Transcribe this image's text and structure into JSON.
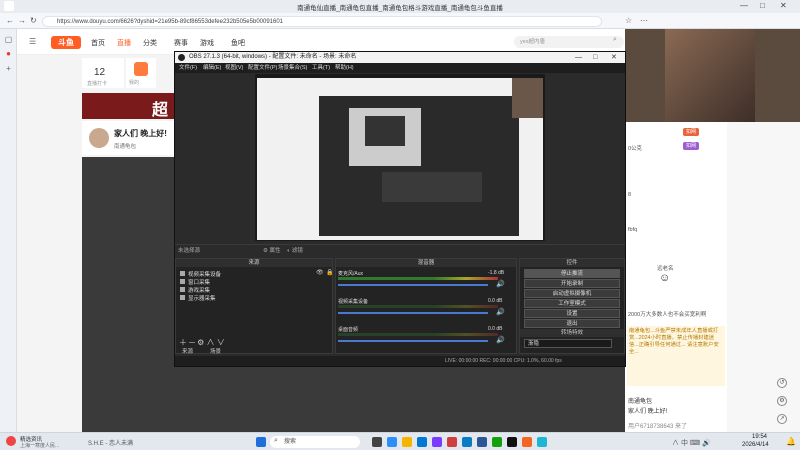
{
  "browser": {
    "title": "南通龟仙直播_南通龟包直播_南通龟包格斗游戏直播_南通龟包斗鱼直播",
    "url": "https://www.douyu.com/6626?dyshid=21e95b-89cf86553defee232b505e5b00091601",
    "win_min": "—",
    "win_max": "□",
    "win_close": "✕"
  },
  "douyu": {
    "logo": "斗鱼",
    "nav": [
      "首页",
      "直播",
      "分类",
      "赛事",
      "游戏",
      "鱼吧"
    ],
    "search_placeholder": "yes超内唐",
    "follow_count": "12",
    "follow_label": "直播打卡",
    "fan_label": "我的",
    "banner_text": "超",
    "streamer_title": "家人们 晚上好!",
    "streamer_tag": "南通龟包"
  },
  "chat": {
    "badges": [
      "扣网",
      "扣网"
    ],
    "lines": [
      "0公克",
      "8",
      "fbfq"
    ],
    "sticker_label": "远老名",
    "announcement": "2000万大多数人也不会买宽利啊",
    "notice": "南通龟包...斗鱼严禁未成年人直播或打赏...2024小时直播，禁止传播封建迷信...正确引导任何通过... 请注意账户安全...",
    "room_label": "南通龟包",
    "topic_label": "家人们 晚上好!",
    "user_msg": "用户6718738643 来了"
  },
  "obs": {
    "title": "OBS 27.1.3 (64-bit, windows) - 配置文件: 未命名 - 场景: 未命名",
    "menu": [
      "文件(F)",
      "编辑(E)",
      "视图(V)",
      "配置文件(P)",
      "场景集合(S)",
      "工具(T)",
      "帮助(H)"
    ],
    "no_source": "未选择源",
    "props_btn": "属性",
    "filter_btn": "滤镜",
    "sources_title": "来源",
    "sources": [
      "视频采集设备",
      "窗口采集",
      "游戏采集",
      "显示器采集"
    ],
    "mixer_title": "混音器",
    "mixer": [
      {
        "name": "麦克风/Aux",
        "db": "-1.8 dB"
      },
      {
        "name": "视频采集设备",
        "db": "0.0 dB"
      },
      {
        "name": "桌面音频",
        "db": "0.0 dB"
      }
    ],
    "controls_title": "控件",
    "controls": [
      "停止推流",
      "开始录制",
      "启动虚拟摄像机",
      "工作室模式",
      "设置",
      "退出"
    ],
    "transitions_title": "转场特效",
    "transition": "渐隐",
    "tab_sources": "来源",
    "tab_scenes": "场景",
    "status": "LIVE: 00:00:00   REC: 00:00:00   CPU: 1.0%, 60.00 fps"
  },
  "taskbar": {
    "weather": "精选资讯",
    "weather_sub": "上海一寒度人民...",
    "media": "S.H.E - 恋人未满",
    "search": "搜索",
    "time": "19:54",
    "date": "2026/4/14"
  },
  "colors": {
    "accent": "#ff5d23",
    "obs_bg": "#2b2b2b"
  }
}
